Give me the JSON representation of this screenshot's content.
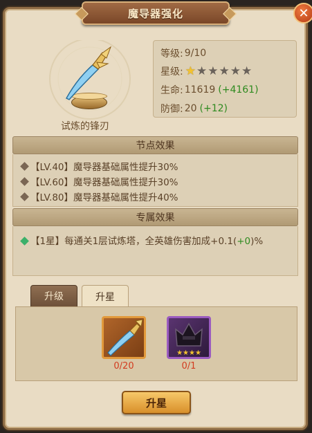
{
  "window": {
    "title": "魔导器强化"
  },
  "weapon": {
    "name": "试炼的锋刃"
  },
  "stats": {
    "level_label": "等级:",
    "level_value": "9/10",
    "star_label": "星级:",
    "stars_filled": 1,
    "stars_total": 6,
    "hp_label": "生命:",
    "hp_value": "11619",
    "hp_bonus": "(+4161)",
    "def_label": "防御:",
    "def_value": "20",
    "def_bonus": "(+12)"
  },
  "node_effects": {
    "title": "节点效果",
    "items": [
      "【LV.40】魔导器基础属性提升30%",
      "【LV.60】魔导器基础属性提升30%",
      "【LV.80】魔导器基础属性提升40%"
    ]
  },
  "exclusive_effects": {
    "title": "专属效果",
    "prefix": "【1星】每通关1层试炼塔，全英雄伤害加成+0.1(",
    "bonus": "+0",
    "suffix": ")%"
  },
  "tabs": [
    {
      "label": "升级"
    },
    {
      "label": "升星"
    }
  ],
  "materials": {
    "sword_count": "0/20",
    "helmet_count": "0/1"
  },
  "action_button": {
    "label": "升星"
  },
  "colors": {
    "accent": "#d88f2a",
    "bonus_green": "#2e8a1f",
    "count_red": "#d23b1f",
    "star_gold": "#f2c230"
  }
}
